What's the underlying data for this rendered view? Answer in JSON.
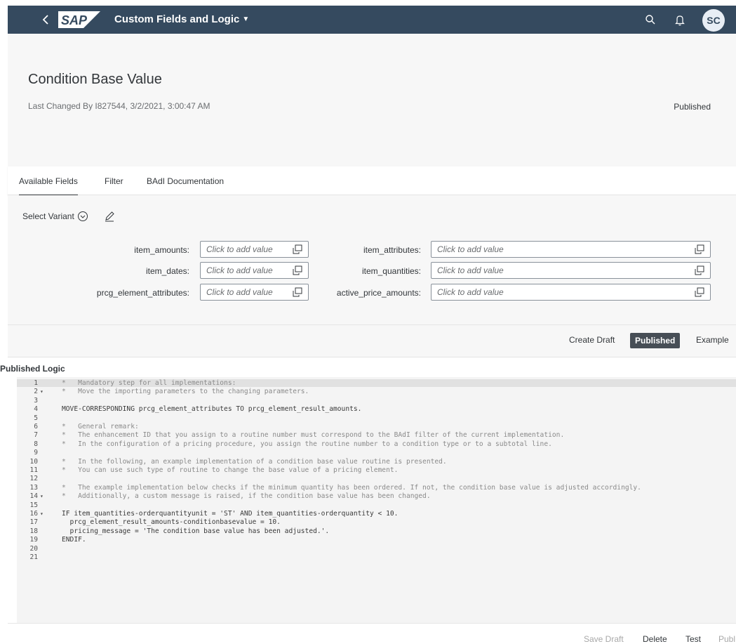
{
  "shell": {
    "logo_text": "SAP",
    "app_title": "Custom Fields and Logic",
    "avatar_initials": "SC",
    "bar_color": "#354a5f"
  },
  "header": {
    "title": "Condition Base Value",
    "last_changed": "Last Changed By I827544, 3/2/2021, 3:00:47 AM",
    "status": "Published"
  },
  "tabs": [
    {
      "label": "Available Fields",
      "active": true
    },
    {
      "label": "Filter",
      "active": false
    },
    {
      "label": "BAdI Documentation",
      "active": false
    }
  ],
  "filter": {
    "variant_label": "Select Variant",
    "fields": [
      {
        "label": "item_amounts:",
        "placeholder": "Click to add value"
      },
      {
        "label": "item_attributes:",
        "placeholder": "Click to add value"
      },
      {
        "label": "item_dates:",
        "placeholder": "Click to add value"
      },
      {
        "label": "item_quantities:",
        "placeholder": "Click to add value"
      },
      {
        "label": "prcg_element_attributes:",
        "placeholder": "Click to add value"
      },
      {
        "label": "active_price_amounts:",
        "placeholder": "Click to add value"
      }
    ]
  },
  "toolbar": {
    "create_draft": "Create Draft",
    "published": "Published",
    "example": "Example"
  },
  "code": {
    "section_title": "Published Logic",
    "lines": [
      {
        "n": "1",
        "fold": "",
        "text": "*   Mandatory step for all implementations:",
        "comment": true
      },
      {
        "n": "2",
        "fold": "▾",
        "text": "*   Move the importing parameters to the changing parameters.",
        "comment": true
      },
      {
        "n": "3",
        "fold": "",
        "text": "",
        "comment": false
      },
      {
        "n": "4",
        "fold": "",
        "text": "MOVE-CORRESPONDING prcg_element_attributes TO prcg_element_result_amounts.",
        "comment": false
      },
      {
        "n": "5",
        "fold": "",
        "text": "",
        "comment": false
      },
      {
        "n": "6",
        "fold": "",
        "text": "*   General remark:",
        "comment": true
      },
      {
        "n": "7",
        "fold": "",
        "text": "*   The enhancement ID that you assign to a routine number must correspond to the BAdI filter of the current implementation.",
        "comment": true
      },
      {
        "n": "8",
        "fold": "",
        "text": "*   In the configuration of a pricing procedure, you assign the routine number to a condition type or to a subtotal line.",
        "comment": true
      },
      {
        "n": "9",
        "fold": "",
        "text": "",
        "comment": false
      },
      {
        "n": "10",
        "fold": "",
        "text": "*   In the following, an example implementation of a condition base value routine is presented.",
        "comment": true
      },
      {
        "n": "11",
        "fold": "",
        "text": "*   You can use such type of routine to change the base value of a pricing element.",
        "comment": true
      },
      {
        "n": "12",
        "fold": "",
        "text": "",
        "comment": false
      },
      {
        "n": "13",
        "fold": "",
        "text": "*   The example implementation below checks if the minimum quantity has been ordered. If not, the condition base value is adjusted accordingly.",
        "comment": true
      },
      {
        "n": "14",
        "fold": "▾",
        "text": "*   Additionally, a custom message is raised, if the condition base value has been changed.",
        "comment": true
      },
      {
        "n": "15",
        "fold": "",
        "text": "",
        "comment": false
      },
      {
        "n": "16",
        "fold": "▾",
        "text": "IF item_quantities-orderquantityunit = 'ST' AND item_quantities-orderquantity < 10.",
        "comment": false
      },
      {
        "n": "17",
        "fold": "",
        "text": "  prcg_element_result_amounts-conditionbasevalue = 10.",
        "comment": false
      },
      {
        "n": "18",
        "fold": "",
        "text": "  pricing_message = 'The condition base value has been adjusted.'.",
        "comment": false
      },
      {
        "n": "19",
        "fold": "",
        "text": "ENDIF.",
        "comment": false
      },
      {
        "n": "20",
        "fold": "",
        "text": "",
        "comment": false
      },
      {
        "n": "21",
        "fold": "",
        "text": "",
        "comment": false
      }
    ]
  },
  "footer": {
    "save_draft": "Save Draft",
    "delete": "Delete",
    "test": "Test",
    "publish": "Publ"
  }
}
